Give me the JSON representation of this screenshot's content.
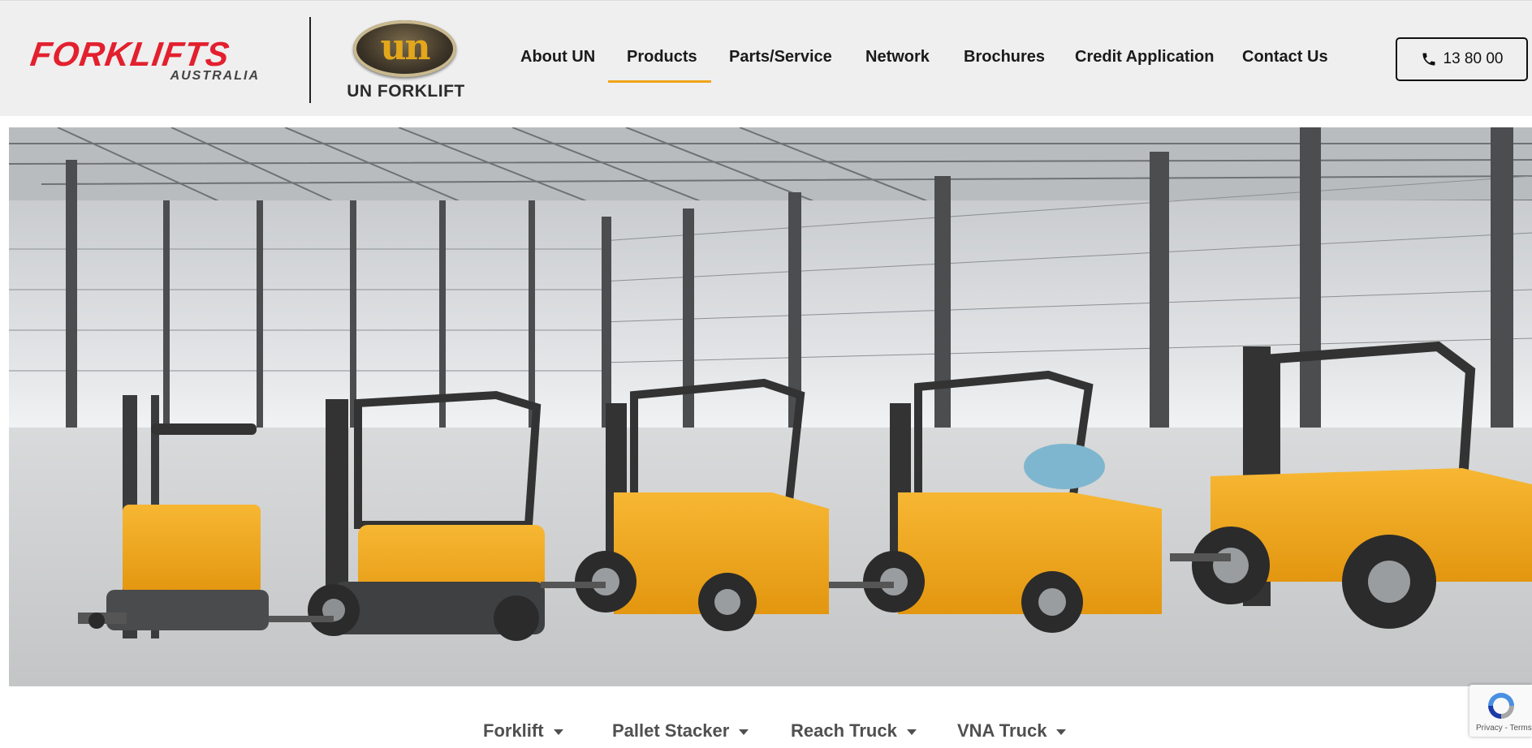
{
  "brand": {
    "primary_name": "FORKLIFTS",
    "primary_sub": "AUSTRALIA",
    "secondary_letters": "un",
    "secondary_name": "UN FORKLIFT"
  },
  "nav": {
    "items": [
      {
        "label": "About UN"
      },
      {
        "label": "Products",
        "active": true
      },
      {
        "label": "Parts/Service"
      },
      {
        "label": "Network"
      },
      {
        "label": "Brochures"
      },
      {
        "label": "Credit Application"
      },
      {
        "label": "Contact Us"
      }
    ],
    "phone": "13 80 00"
  },
  "submenu": {
    "items": [
      {
        "label": "Forklift"
      },
      {
        "label": "Pallet Stacker"
      },
      {
        "label": "Reach Truck"
      },
      {
        "label": "VNA Truck"
      }
    ]
  },
  "recaptcha": {
    "links": "Privacy - Terms"
  },
  "colors": {
    "brand_red": "#e3202e",
    "accent_yellow": "#f0a419",
    "forklift_body": "#f2a81d",
    "text_dark": "#1a1a1a"
  }
}
